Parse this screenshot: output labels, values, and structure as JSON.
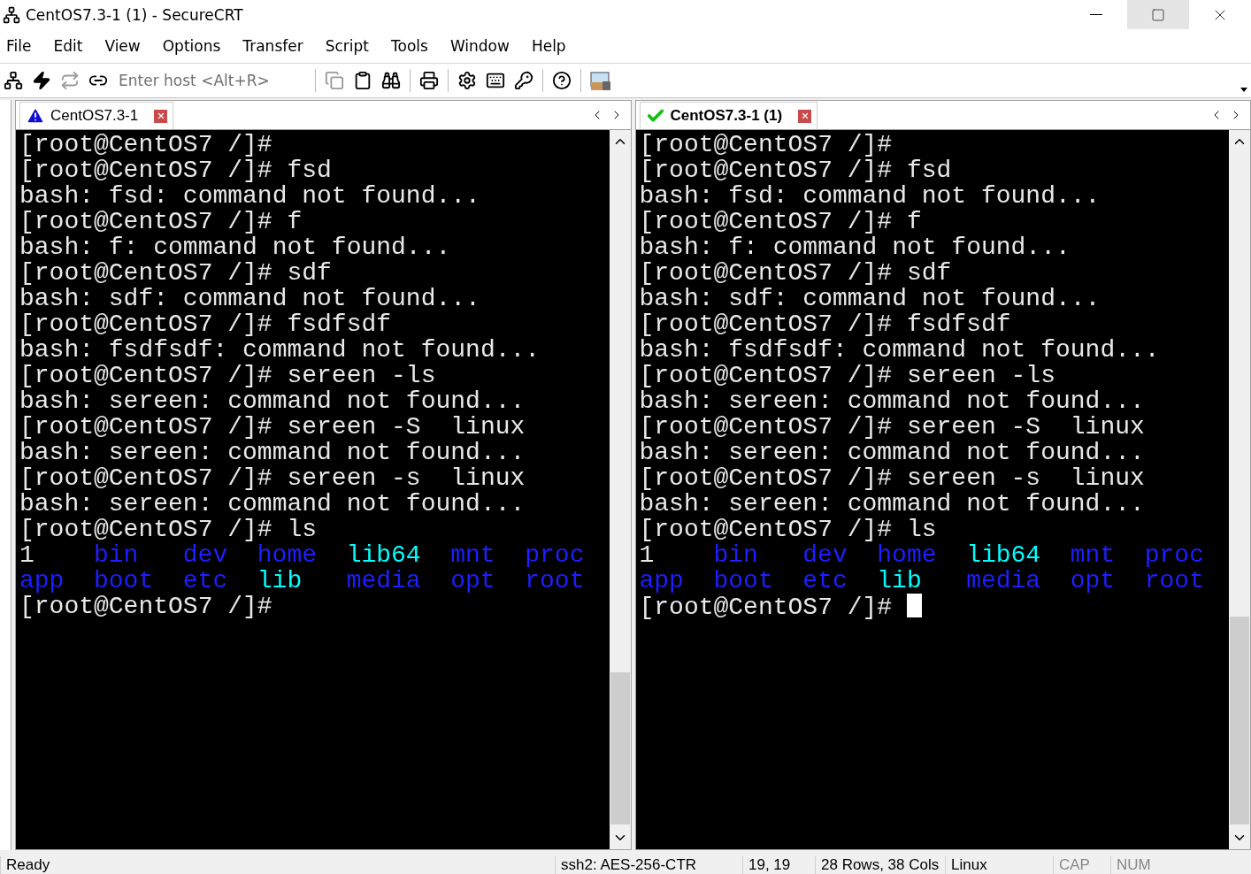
{
  "window": {
    "title": "CentOS7.3-1 (1) - SecureCRT"
  },
  "menu": [
    "File",
    "Edit",
    "View",
    "Options",
    "Transfer",
    "Script",
    "Tools",
    "Window",
    "Help"
  ],
  "toolbar": {
    "host_placeholder": "Enter host <Alt+R>"
  },
  "panes": [
    {
      "tab": {
        "label": "CentOS7.3-1",
        "kind": "warning",
        "selected": false
      },
      "cursor": false,
      "lines": [
        {
          "kind": "text",
          "text": "[root@CentOS7 /]#"
        },
        {
          "kind": "text",
          "text": "[root@CentOS7 /]# fsd"
        },
        {
          "kind": "text",
          "text": "bash: fsd: command not found..."
        },
        {
          "kind": "text",
          "text": "[root@CentOS7 /]# f"
        },
        {
          "kind": "text",
          "text": "bash: f: command not found..."
        },
        {
          "kind": "text",
          "text": "[root@CentOS7 /]# sdf"
        },
        {
          "kind": "text",
          "text": "bash: sdf: command not found..."
        },
        {
          "kind": "text",
          "text": "[root@CentOS7 /]# fsdfsdf"
        },
        {
          "kind": "text",
          "text": "bash: fsdfsdf: command not found..."
        },
        {
          "kind": "text",
          "text": "[root@CentOS7 /]# sereen -ls"
        },
        {
          "kind": "text",
          "text": "bash: sereen: command not found..."
        },
        {
          "kind": "text",
          "text": "[root@CentOS7 /]# sereen -S  linux"
        },
        {
          "kind": "text",
          "text": "bash: sereen: command not found..."
        },
        {
          "kind": "text",
          "text": "[root@CentOS7 /]# sereen -s  linux"
        },
        {
          "kind": "text",
          "text": "bash: sereen: command not found..."
        },
        {
          "kind": "text",
          "text": "[root@CentOS7 /]# ls"
        },
        {
          "kind": "ls",
          "items": [
            {
              "text": "1",
              "color": "#e8e8e8"
            },
            {
              "text": "bin",
              "color": "#1e1eff"
            },
            {
              "text": "dev",
              "color": "#1e1eff"
            },
            {
              "text": "home",
              "color": "#1e1eff"
            },
            {
              "text": "lib64",
              "color": "#00ffff"
            },
            {
              "text": "mnt",
              "color": "#1e1eff"
            },
            {
              "text": "proc",
              "color": "#1e1eff"
            }
          ]
        },
        {
          "kind": "ls",
          "items": [
            {
              "text": "app",
              "color": "#1e1eff"
            },
            {
              "text": "boot",
              "color": "#1e1eff"
            },
            {
              "text": "etc",
              "color": "#1e1eff"
            },
            {
              "text": "lib",
              "color": "#00ffff"
            },
            {
              "text": "media",
              "color": "#1e1eff"
            },
            {
              "text": "opt",
              "color": "#1e1eff"
            },
            {
              "text": "root",
              "color": "#1e1eff"
            }
          ]
        },
        {
          "kind": "text",
          "text": "[root@CentOS7 /]#"
        }
      ]
    },
    {
      "tab": {
        "label": "CentOS7.3-1 (1)",
        "kind": "connected",
        "selected": true
      },
      "cursor": true,
      "lines": [
        {
          "kind": "text",
          "text": "[root@CentOS7 /]#"
        },
        {
          "kind": "text",
          "text": "[root@CentOS7 /]# fsd"
        },
        {
          "kind": "text",
          "text": "bash: fsd: command not found..."
        },
        {
          "kind": "text",
          "text": "[root@CentOS7 /]# f"
        },
        {
          "kind": "text",
          "text": "bash: f: command not found..."
        },
        {
          "kind": "text",
          "text": "[root@CentOS7 /]# sdf"
        },
        {
          "kind": "text",
          "text": "bash: sdf: command not found..."
        },
        {
          "kind": "text",
          "text": "[root@CentOS7 /]# fsdfsdf"
        },
        {
          "kind": "text",
          "text": "bash: fsdfsdf: command not found..."
        },
        {
          "kind": "text",
          "text": "[root@CentOS7 /]# sereen -ls"
        },
        {
          "kind": "text",
          "text": "bash: sereen: command not found..."
        },
        {
          "kind": "text",
          "text": "[root@CentOS7 /]# sereen -S  linux"
        },
        {
          "kind": "text",
          "text": "bash: sereen: command not found..."
        },
        {
          "kind": "text",
          "text": "[root@CentOS7 /]# sereen -s  linux"
        },
        {
          "kind": "text",
          "text": "bash: sereen: command not found..."
        },
        {
          "kind": "text",
          "text": "[root@CentOS7 /]# ls"
        },
        {
          "kind": "ls",
          "items": [
            {
              "text": "1",
              "color": "#e8e8e8"
            },
            {
              "text": "bin",
              "color": "#1e1eff"
            },
            {
              "text": "dev",
              "color": "#1e1eff"
            },
            {
              "text": "home",
              "color": "#1e1eff"
            },
            {
              "text": "lib64",
              "color": "#00ffff"
            },
            {
              "text": "mnt",
              "color": "#1e1eff"
            },
            {
              "text": "proc",
              "color": "#1e1eff"
            }
          ]
        },
        {
          "kind": "ls",
          "items": [
            {
              "text": "app",
              "color": "#1e1eff"
            },
            {
              "text": "boot",
              "color": "#1e1eff"
            },
            {
              "text": "etc",
              "color": "#1e1eff"
            },
            {
              "text": "lib",
              "color": "#00ffff"
            },
            {
              "text": "media",
              "color": "#1e1eff"
            },
            {
              "text": "opt",
              "color": "#1e1eff"
            },
            {
              "text": "root",
              "color": "#1e1eff"
            }
          ]
        },
        {
          "kind": "text",
          "text": "[root@CentOS7 /]#"
        }
      ]
    }
  ],
  "status_bar": [
    {
      "text": "Ready",
      "disabled": false
    },
    {
      "text": "ssh2: AES-256-CTR",
      "disabled": false
    },
    {
      "text": "19,  19",
      "disabled": false
    },
    {
      "text": "28 Rows, 38 Cols",
      "disabled": false
    },
    {
      "text": "Linux",
      "disabled": false
    },
    {
      "text": "CAP",
      "disabled": true
    },
    {
      "text": "NUM",
      "disabled": true
    }
  ]
}
